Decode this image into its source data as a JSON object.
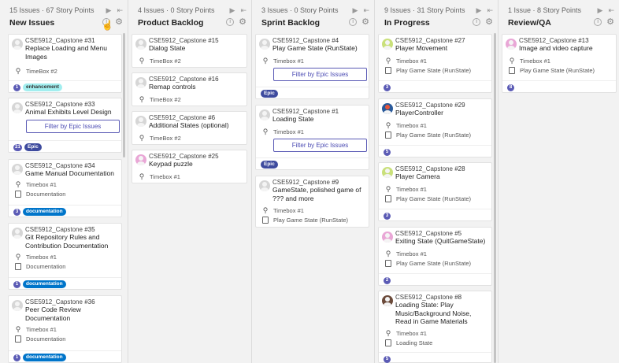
{
  "columns": [
    {
      "meta": "15 Issues · 67 Story Points",
      "title": "New Issues"
    },
    {
      "meta": "4 Issues · 0 Story Points",
      "title": "Product Backlog"
    },
    {
      "meta": "3 Issues · 0 Story Points",
      "title": "Sprint Backlog"
    },
    {
      "meta": "9 Issues · 31 Story Points",
      "title": "In Progress"
    },
    {
      "meta": "1 Issue · 8 Story Points",
      "title": "Review/QA"
    }
  ],
  "filter_label": "Filter by Epic Issues",
  "cards": {
    "c31": {
      "repo": "CSE5912_Capstone",
      "num": "#31",
      "title": "Replace Loading and Menu Images",
      "timebox": "TimeBox #2",
      "points": "1",
      "label": "enhancement"
    },
    "c33": {
      "repo": "CSE5912_Capstone",
      "num": "#33",
      "title": "Animal Exhibits Level Design",
      "points": "21",
      "label": "Epic"
    },
    "c34": {
      "repo": "CSE5912_Capstone",
      "num": "#34",
      "title": "Game Manual Documentation",
      "timebox": "Timebox #1",
      "epic": "Documentation",
      "points": "3",
      "label": "documentation"
    },
    "c35": {
      "repo": "CSE5912_Capstone",
      "num": "#35",
      "title": "Git Repository Rules and Contribution Documentation",
      "timebox": "Timebox #1",
      "epic": "Documentation",
      "points": "1",
      "label": "documentation"
    },
    "c36": {
      "repo": "CSE5912_Capstone",
      "num": "#36",
      "title": "Peer Code Review Documentation",
      "timebox": "Timebox #1",
      "epic": "Documentation",
      "points": "1",
      "label": "documentation"
    },
    "c15": {
      "repo": "CSE5912_Capstone",
      "num": "#15",
      "title": "Dialog State",
      "timebox": "TimeBox #2"
    },
    "c16": {
      "repo": "CSE5912_Capstone",
      "num": "#16",
      "title": "Remap controls",
      "timebox": "TimeBox #2"
    },
    "c6": {
      "repo": "CSE5912_Capstone",
      "num": "#6",
      "title": "Additional States (optional)",
      "timebox": "TimeBox #2"
    },
    "c25": {
      "repo": "CSE5912_Capstone",
      "num": "#25",
      "title": "Keypad puzzle",
      "timebox": "Timebox #1"
    },
    "c4": {
      "repo": "CSE5912_Capstone",
      "num": "#4",
      "title": "Play Game State (RunState)",
      "timebox": "Timebox #1",
      "label": "Epic"
    },
    "c1": {
      "repo": "CSE5912_Capstone",
      "num": "#1",
      "title": "Loading State",
      "timebox": "Timebox #1",
      "label": "Epic"
    },
    "c9": {
      "repo": "CSE5912_Capstone",
      "num": "#9",
      "title": "GameState, polished game of ??? and more",
      "timebox": "Timebox #1",
      "epic": "Play Game State (RunState)"
    },
    "c27": {
      "repo": "CSE5912_Capstone",
      "num": "#27",
      "title": "Player Movement",
      "timebox": "Timebox #1",
      "epic": "Play Game State (RunState)",
      "points": "3"
    },
    "c29": {
      "repo": "CSE5912_Capstone",
      "num": "#29",
      "title": "PlayerController",
      "timebox": "Timebox #1",
      "epic": "Play Game State (RunState)",
      "points": "5"
    },
    "c28": {
      "repo": "CSE5912_Capstone",
      "num": "#28",
      "title": "Player Camera",
      "timebox": "Timebox #1",
      "epic": "Play Game State (RunState)",
      "points": "3"
    },
    "c5": {
      "repo": "CSE5912_Capstone",
      "num": "#5",
      "title": "Exiting State (QuitGameState)",
      "timebox": "Timebox #1",
      "epic": "Play Game State (RunState)",
      "points": "2"
    },
    "c8": {
      "repo": "CSE5912_Capstone",
      "num": "#8",
      "title": "Loading State: Play Music/Background Noise, Read in Game Materials",
      "timebox": "Timebox #1",
      "epic": "Loading State",
      "points": "5"
    },
    "c13": {
      "repo": "CSE5912_Capstone",
      "num": "#13",
      "title": "Image and video capture",
      "timebox": "Timebox #1",
      "epic": "Play Game State (RunState)",
      "points": "8"
    }
  },
  "colors": {
    "enhancement": "#a2eeef",
    "documentation": "#0075ca",
    "epic": "#3e4b9e",
    "points": "#5b5bb5"
  }
}
